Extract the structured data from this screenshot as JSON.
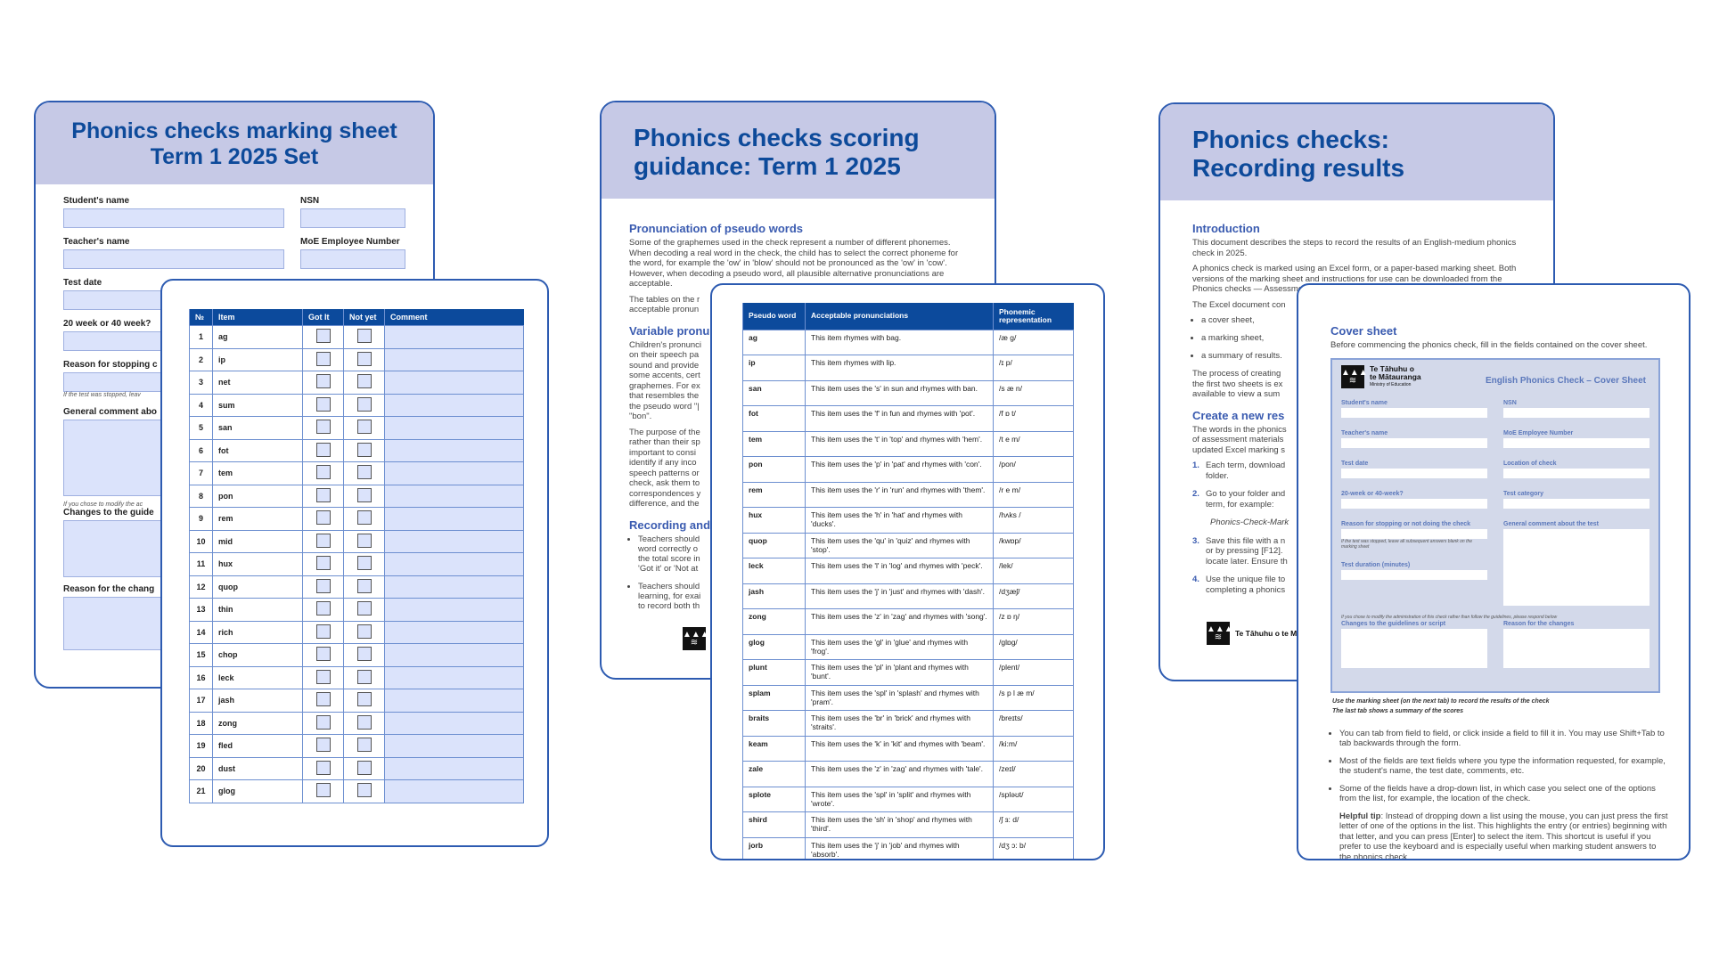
{
  "marking_sheet": {
    "title_line1": "Phonics checks marking sheet",
    "title_line2": "Term 1 2025 Set",
    "fields": {
      "student_name": "Student's name",
      "nsn": "NSN",
      "teacher_name": "Teacher's name",
      "moe_number": "MoE Employee Number",
      "test_date": "Test date",
      "week": "20 week or 40 week?",
      "reason_stopping": "Reason for stopping c",
      "stopped_note": "If the test was stopped, leav",
      "general_comment": "General comment abo",
      "modify_note": "If you chose to modify the ac",
      "changes": "Changes to the guide",
      "reason_changes": "Reason for the chang"
    },
    "table": {
      "headers": [
        "№",
        "Item",
        "Got It",
        "Not yet",
        "Comment"
      ],
      "rows": [
        [
          "1",
          "ag"
        ],
        [
          "2",
          "ip"
        ],
        [
          "3",
          "net"
        ],
        [
          "4",
          "sum"
        ],
        [
          "5",
          "san"
        ],
        [
          "6",
          "fot"
        ],
        [
          "7",
          "tem"
        ],
        [
          "8",
          "pon"
        ],
        [
          "9",
          "rem"
        ],
        [
          "10",
          "mid"
        ],
        [
          "11",
          "hux"
        ],
        [
          "12",
          "quop"
        ],
        [
          "13",
          "thin"
        ],
        [
          "14",
          "rich"
        ],
        [
          "15",
          "chop"
        ],
        [
          "16",
          "leck"
        ],
        [
          "17",
          "jash"
        ],
        [
          "18",
          "zong"
        ],
        [
          "19",
          "fled"
        ],
        [
          "20",
          "dust"
        ],
        [
          "21",
          "glog"
        ]
      ]
    }
  },
  "scoring": {
    "title_line1": "Phonics checks scoring",
    "title_line2": "guidance: Term 1 2025",
    "sec1": "Pronunciation of pseudo words",
    "p1": "Some of the graphemes used in the check represent a number of different phonemes. When decoding a real word in the check, the child has to select the correct phoneme for the word, for example the 'ow' in 'blow' should not be pronounced as the 'ow' in 'cow'. However, when decoding a pseudo word, all plausible alternative pronunciations are acceptable.",
    "p2": "The tables on the r acceptable pronun",
    "sec2": "Variable pronu",
    "p3": "Children's pronunci on their speech pa sound and provide some accents, cert graphemes. For ex that resembles the the pseudo word \"| \"bon\".",
    "p4": "The purpose of the rather than their sp important to consi identify if any inco speech patterns or check, ask them to correspondences y difference, and the",
    "sec3": "Recording and",
    "bullets": [
      "Teachers should word correctly o the total score in 'Got it' or 'Not at",
      "Teachers should learning, for exai to record both th"
    ],
    "table": {
      "headers": [
        "Pseudo word",
        "Acceptable pronunciations",
        "Phonemic representation"
      ],
      "rows": [
        [
          "ag",
          "This item rhymes with bag.",
          "/æ g/"
        ],
        [
          "ip",
          "This item rhymes with lip.",
          "/ɪ p/"
        ],
        [
          "san",
          "This item uses the 's' in sun and rhymes with ban.",
          "/s æ n/"
        ],
        [
          "fot",
          "This item uses the 'f' in fun and rhymes with 'pot'.",
          "/f ɒ t/"
        ],
        [
          "tem",
          "This item uses the 't' in 'top' and rhymes with 'hem'.",
          "/t e m/"
        ],
        [
          "pon",
          "This item uses the 'p' in 'pat' and rhymes with 'con'.",
          "/pon/"
        ],
        [
          "rem",
          "This item uses the 'r' in 'run' and rhymes with 'them'.",
          "/r e m/"
        ],
        [
          "hux",
          "This item uses the 'h' in 'hat' and rhymes with 'ducks'.",
          "/hʌks /"
        ],
        [
          "quop",
          "This item uses the 'qu' in 'quiz' and rhymes with 'stop'.",
          "/kwɒp/"
        ],
        [
          "leck",
          "This item uses the 'l' in 'log' and rhymes with 'peck'.",
          "/lek/"
        ],
        [
          "jash",
          "This item uses the 'j' in 'just' and rhymes with 'dash'.",
          "/dʒæʃ/"
        ],
        [
          "zong",
          "This item uses the 'z' in 'zag' and rhymes with 'song'.",
          "/z ɒ ŋ/"
        ],
        [
          "glog",
          "This item uses the 'gl' in 'glue' and rhymes with 'frog'.",
          "/glɒg/"
        ],
        [
          "plunt",
          "This item uses the 'pl' in 'plant and rhymes with 'bunt'.",
          "/plent/"
        ],
        [
          "splam",
          "This item uses the 'spl' in 'splash' and rhymes with 'pram'.",
          "/s p l æ m/"
        ],
        [
          "braits",
          "This item uses the 'br' in 'brick' and rhymes with 'straits'.",
          "/breɪts/"
        ],
        [
          "keam",
          "This item uses the 'k' in 'kit' and rhymes with 'beam'.",
          "/ki:m/"
        ],
        [
          "zale",
          "This item uses the 'z' in 'zag' and rhymes with 'tale'.",
          "/zeɪl/"
        ],
        [
          "splote",
          "This item uses the 'spl' in 'split' and rhymes with 'wrote'.",
          "/spləʊt/"
        ],
        [
          "shird",
          "This item uses the 'sh' in 'shop' and rhymes with 'third'.",
          "/ʃ ɜ: d/"
        ],
        [
          "jorb",
          "This item uses the 'j' in 'job' and rhymes with 'absorb'.",
          "/dʒ ɔ: b/"
        ]
      ]
    }
  },
  "recording": {
    "title_line1": "Phonics checks:",
    "title_line2": "Recording results",
    "sec1": "Introduction",
    "p1": "This document describes the steps to record the results of an English-medium phonics check in 2025.",
    "p2": "A phonics check is marked using an Excel form, or a paper-based marking sheet. Both versions of the marking sheet and instructions for use can be downloaded from the Phonics checks — Assessment materials Tāhūrangi page.",
    "p3": "The Excel document con",
    "list": [
      "a cover sheet,",
      "a marking sheet,",
      "a summary of results."
    ],
    "p4": "The process of creating the first two sheets is ex available to view a sum",
    "sec2": "Create a new res",
    "p5": "The words in the phonics of assessment materials updated Excel marking s",
    "steps": [
      [
        "1.",
        "Each term, download folder."
      ],
      [
        "2.",
        "Go to your folder and term, for example:"
      ],
      [
        "3.",
        "Save this file with a n or by pressing [F12]. locate later. Ensure th"
      ],
      [
        "4.",
        "Use the unique file to completing a phonics"
      ]
    ],
    "example_file": "Phonics-Check-Mark",
    "logo_name": "Te Tāhuhu o te Mātauranga"
  },
  "cover": {
    "heading": "Cover sheet",
    "intro": "Before commencing the phonics check, fill in the fields contained on the cover sheet.",
    "logo_line1": "Te Tāhuhu o",
    "logo_line2": "te Mātauranga",
    "logo_sub": "Ministry of Education",
    "sheet_title": "English Phonics Check – Cover Sheet",
    "fields": [
      "Student's name",
      "NSN",
      "Teacher's name",
      "MoE Employee Number",
      "Test date",
      "Location of check",
      "20-week or 40-week?",
      "Test category"
    ],
    "reason_label": "Reason for stopping or not doing the check",
    "reason_note": "If the test was stopped, leave all subsequent answers blank on the marking sheet",
    "duration_label": "Test duration (minutes)",
    "general_label": "General comment about the test",
    "modify_note": "If you chose to modify the administration of this check rather than follow the guidelines, please respond below",
    "changes_label": "Changes to the guidelines or script",
    "reason_changes_label": "Reason for the changes",
    "foot1": "Use the marking sheet (on the next tab) to record the results of the check",
    "foot2": "The last tab shows a summary of the scores",
    "bullets": [
      "You can tab from field to field, or click inside a field to fill it in. You may use Shift+Tab to tab backwards through the form.",
      "Most of the fields are text fields where you type the information requested, for example, the student's name, the test date, comments, etc.",
      "Some of the fields have a drop-down list, in which case you select one of the options from the list, for example, the location of the check."
    ],
    "tip_label": "Helpful tip",
    "tip": ": Instead of dropping down a list using the mouse, you can just press the first letter of one of the options in the list. This highlights the entry (or entries) beginning with that letter, and you can press [Enter] to select the item. This shortcut is useful if you prefer to use the keyboard and is especially useful when marking student answers to the phonics check."
  },
  "colors": {
    "accent": "#0d4a9a",
    "band": "#c6c9e6",
    "field": "#dbe3fb",
    "border": "#2d5bb1"
  }
}
